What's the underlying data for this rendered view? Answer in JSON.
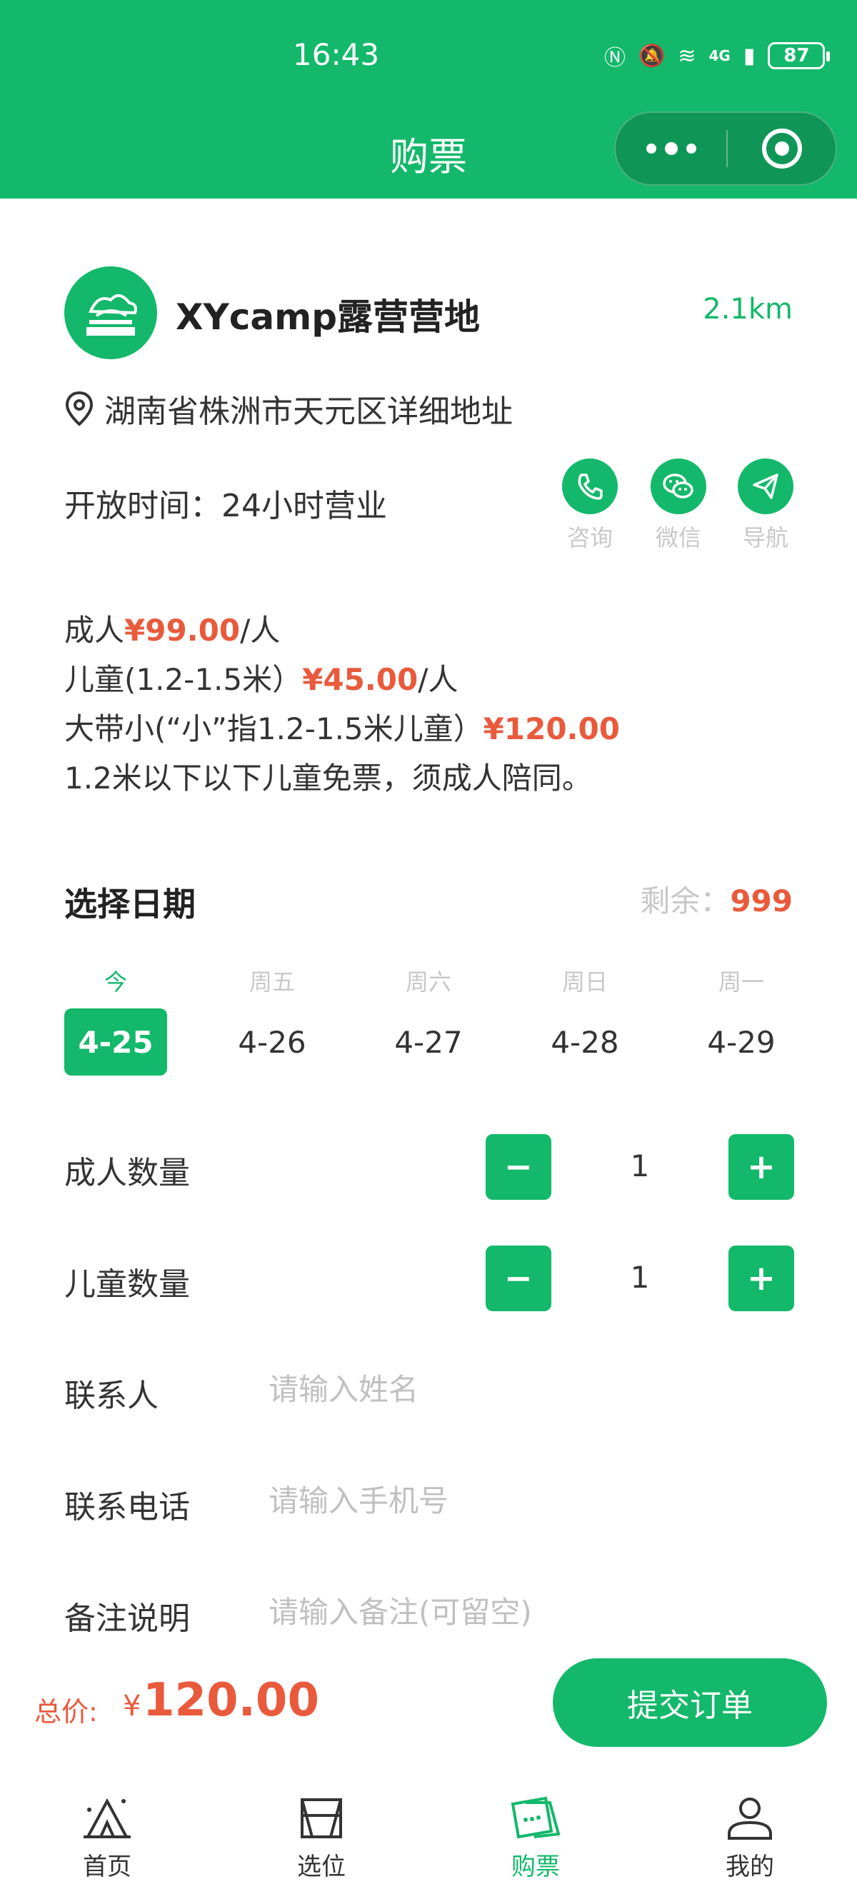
{
  "status_bar": {
    "time": "16:43",
    "battery": "87",
    "network": "4G"
  },
  "header": {
    "title": "购票"
  },
  "camp": {
    "name": "XYcamp露营营地",
    "distance": "2.1km",
    "address": "湖南省株洲市天元区详细地址",
    "hours_label": "开放时间：",
    "hours_value": "24小时营业",
    "actions": [
      {
        "label": "咨询",
        "icon": "phone-icon"
      },
      {
        "label": "微信",
        "icon": "wechat-icon"
      },
      {
        "label": "导航",
        "icon": "navigation-icon"
      }
    ]
  },
  "prices": {
    "adult_prefix": "成人",
    "adult_price": "¥99.00",
    "adult_suffix": "/人",
    "child_prefix": "儿童(1.2-1.5米）",
    "child_price": "¥45.00",
    "child_suffix": "/人",
    "family_prefix": "大带小(“小”指1.2-1.5米儿童）",
    "family_price": "¥120.00",
    "note": "1.2米以下以下儿童免票，须成人陪同。"
  },
  "date_section": {
    "title": "选择日期",
    "remain_label": "剩余：",
    "remain_value": "999",
    "dates": [
      {
        "weekday": "今",
        "date": "4-25"
      },
      {
        "weekday": "周五",
        "date": "4-26"
      },
      {
        "weekday": "周六",
        "date": "4-27"
      },
      {
        "weekday": "周日",
        "date": "4-28"
      },
      {
        "weekday": "周一",
        "date": "4-29"
      }
    ]
  },
  "form": {
    "adult_count_label": "成人数量",
    "adult_count": "1",
    "child_count_label": "儿童数量",
    "child_count": "1",
    "minus": "−",
    "plus": "+",
    "contact_label": "联系人",
    "contact_placeholder": "请输入姓名",
    "phone_label": "联系电话",
    "phone_placeholder": "请输入手机号",
    "remark_label": "备注说明",
    "remark_placeholder": "请输入备注(可留空)"
  },
  "footer": {
    "total_label": "总价:",
    "currency": "¥",
    "total_value": "120.00",
    "submit_label": "提交订单"
  },
  "tabbar": [
    {
      "label": "首页",
      "icon": "tent-icon"
    },
    {
      "label": "选位",
      "icon": "map-icon"
    },
    {
      "label": "购票",
      "icon": "ticket-icon"
    },
    {
      "label": "我的",
      "icon": "user-icon"
    }
  ],
  "colors": {
    "primary": "#13b86a",
    "price": "#e95a3c",
    "muted": "#c8c8c8"
  }
}
